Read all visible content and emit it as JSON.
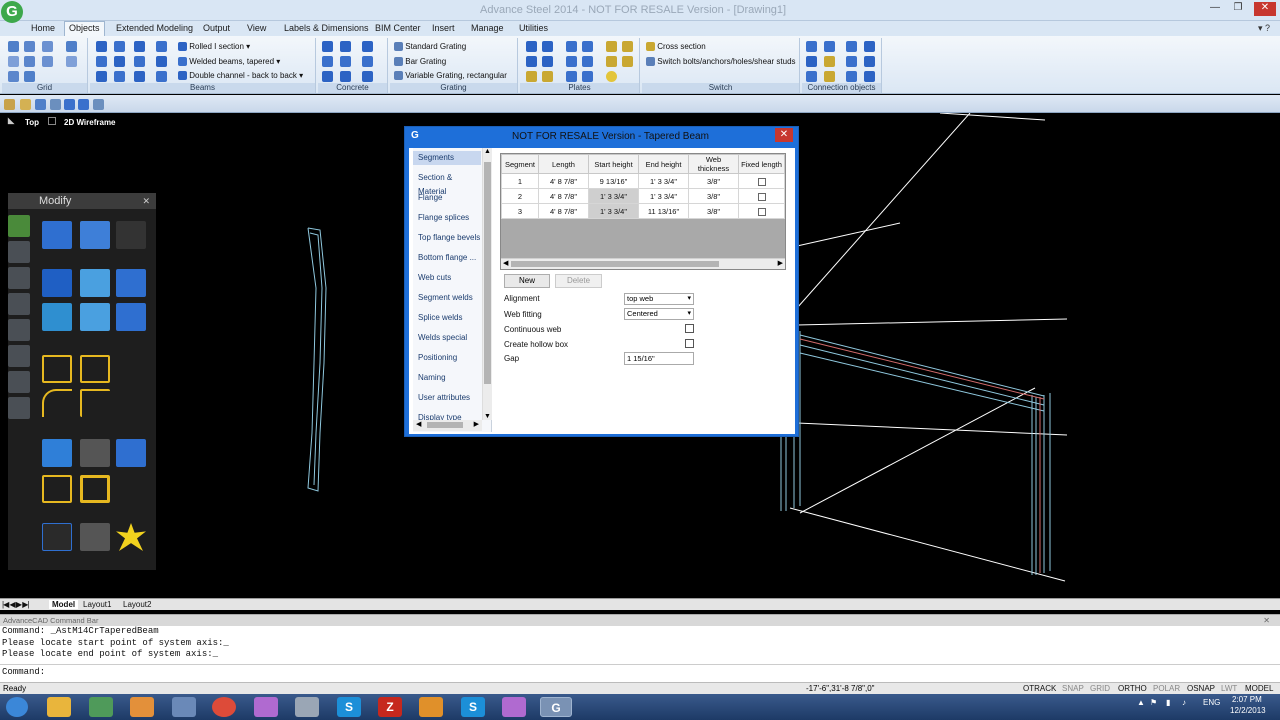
{
  "window": {
    "title": "Advance Steel 2014 - NOT FOR RESALE Version - [Drawing1]",
    "logo": "G"
  },
  "ribbon": {
    "tabs": [
      "Home",
      "Objects",
      "Extended Modeling",
      "Output",
      "View",
      "Labels & Dimensions",
      "BIM Center",
      "Insert",
      "Manage",
      "Utilities"
    ],
    "active_tab": "Objects",
    "groups": [
      "Grid",
      "Beams",
      "Concrete",
      "Grating",
      "Plates",
      "Switch",
      "Connection objects"
    ],
    "beam_items": [
      "Rolled I section",
      "Welded beams, tapered",
      "Double channel - back to back"
    ],
    "grating_items": [
      "Standard Grating",
      "Bar Grating",
      "Variable Grating, rectangular"
    ],
    "switch_items": [
      "Cross section",
      "Switch bolts/anchors/holes/shear studs"
    ]
  },
  "viewport": {
    "view_name": "Top",
    "visual_style": "2D Wireframe"
  },
  "modify_panel": {
    "title": "Modify"
  },
  "dialog": {
    "title": "NOT FOR RESALE Version - Tapered Beam",
    "nav": [
      "Segments",
      "Section & Material",
      "Flange",
      "Flange splices",
      "Top flange bevels",
      "Bottom flange ...",
      "Web cuts",
      "Segment welds",
      "Splice welds",
      "Welds special",
      "Positioning",
      "Naming",
      "User attributes",
      "Display type"
    ],
    "selected_nav": "Segments",
    "columns": [
      "Segment",
      "Length",
      "Start height",
      "End height",
      "Web thickness",
      "Fixed length"
    ],
    "rows": [
      {
        "segment": "1",
        "length": "4' 8 7/8\"",
        "start": "9 13/16\"",
        "end": "1' 3 3/4\"",
        "web": "3/8\""
      },
      {
        "segment": "2",
        "length": "4' 8 7/8\"",
        "start": "1' 3 3/4\"",
        "end": "1' 3 3/4\"",
        "web": "3/8\""
      },
      {
        "segment": "3",
        "length": "4' 8 7/8\"",
        "start": "1' 3 3/4\"",
        "end": "11 13/16\"",
        "web": "3/8\""
      }
    ],
    "new_button": "New",
    "delete_button": "Delete",
    "alignment_label": "Alignment",
    "alignment_value": "top web",
    "web_fitting_label": "Web fitting",
    "web_fitting_value": "Centered",
    "continuous_web_label": "Continuous web",
    "hollow_box_label": "Create hollow box",
    "gap_label": "Gap",
    "gap_value": "1 15/16\""
  },
  "layout_tabs": [
    "Model",
    "Layout1",
    "Layout2"
  ],
  "command_bar": {
    "title": "AdvanceCAD Command Bar",
    "history": [
      "Command: _AstM14CrTaperedBeam",
      "Please locate start point of system axis:_",
      "Please locate end point of system axis:_"
    ],
    "prompt": "Command:"
  },
  "status": {
    "ready": "Ready",
    "coords": "-17'-6\",31'-8 7/8\",0\"",
    "toggles": [
      "OTRACK",
      "SNAP",
      "GRID",
      "ORTHO",
      "POLAR",
      "OSNAP",
      "LWT",
      "MODEL"
    ]
  },
  "taskbar": {
    "lang": "ENG",
    "time": "2:07 PM",
    "date": "12/2/2013"
  }
}
